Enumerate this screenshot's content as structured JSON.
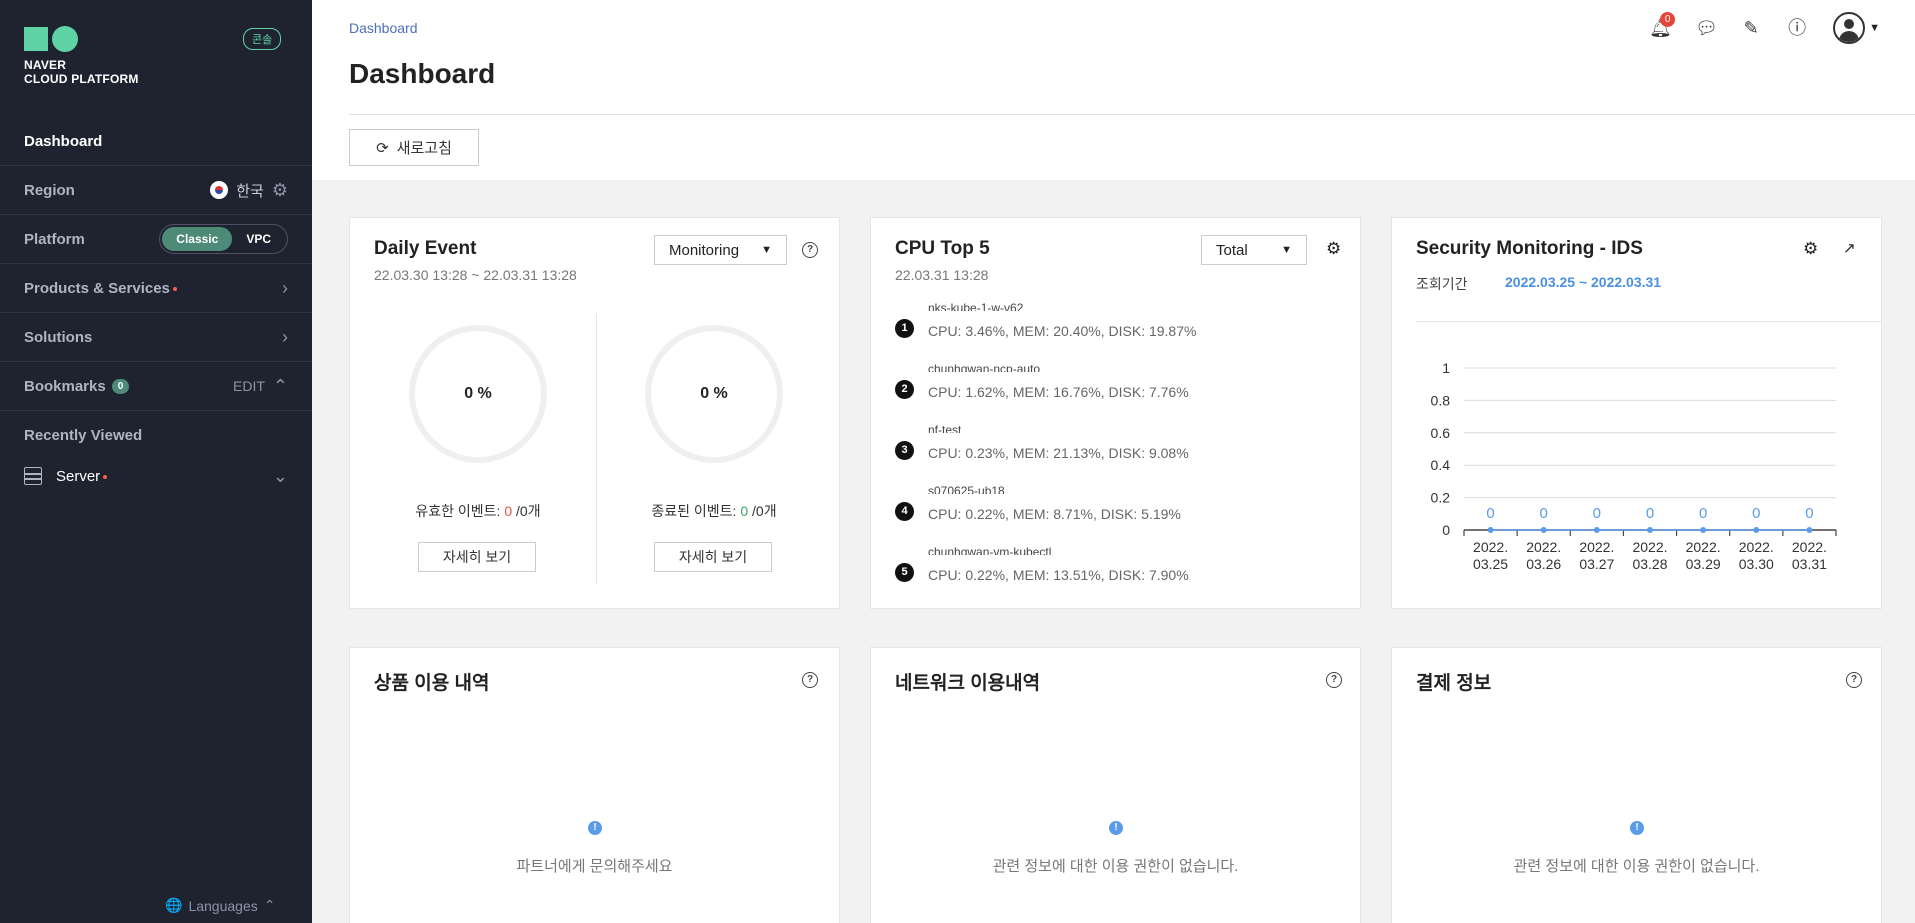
{
  "sidebar": {
    "logo_line1": "NAVER",
    "logo_line2": "CLOUD PLATFORM",
    "console_badge": "콘솔",
    "dashboard": "Dashboard",
    "region_label": "Region",
    "region_value": "한국",
    "platform_label": "Platform",
    "platform_classic": "Classic",
    "platform_vpc": "VPC",
    "products": "Products & Services",
    "solutions": "Solutions",
    "bookmarks": "Bookmarks",
    "bookmarks_count": "0",
    "bookmarks_edit": "EDIT",
    "recently_viewed": "Recently Viewed",
    "server": "Server",
    "languages": "Languages"
  },
  "header": {
    "breadcrumb": "Dashboard",
    "title": "Dashboard",
    "refresh": "새로고침",
    "notification_count": "0"
  },
  "daily_event": {
    "title": "Daily Event",
    "range": "22.03.30 13:28 ~ 22.03.31 13:28",
    "dropdown": "Monitoring",
    "left_value": "0 %",
    "right_value": "0 %",
    "left_label": "유효한 이벤트: ",
    "left_count": "0",
    "left_total": " /0개",
    "right_label": "종료된 이벤트: ",
    "right_count": "0",
    "right_total": " /0개",
    "detail": "자세히 보기"
  },
  "cpu_top5": {
    "title": "CPU Top 5",
    "time": "22.03.31 13:28",
    "dropdown": "Total",
    "items": [
      {
        "rank": "1",
        "name": "nks-kube-1-w-v62",
        "stat": "CPU: 3.46%, MEM: 20.40%, DISK: 19.87%"
      },
      {
        "rank": "2",
        "name": "chunhgwan-ncp-auto",
        "stat": "CPU: 1.62%, MEM: 16.76%, DISK: 7.76%"
      },
      {
        "rank": "3",
        "name": "nf-test",
        "stat": "CPU: 0.23%, MEM: 21.13%, DISK: 9.08%"
      },
      {
        "rank": "4",
        "name": "s070625-ub18",
        "stat": "CPU: 0.22%, MEM: 8.71%, DISK: 5.19%"
      },
      {
        "rank": "5",
        "name": "chunhgwan-vm-kubectl",
        "stat": "CPU: 0.22%, MEM: 13.51%, DISK: 7.90%"
      }
    ]
  },
  "ids": {
    "title": "Security Monitoring - IDS",
    "period_label": "조회기간",
    "period_value": "2022.03.25 ~ 2022.03.31"
  },
  "chart_data": {
    "type": "line",
    "categories": [
      "2022.03.25",
      "2022.03.26",
      "2022.03.27",
      "2022.03.28",
      "2022.03.29",
      "2022.03.30",
      "2022.03.31"
    ],
    "values": [
      0,
      0,
      0,
      0,
      0,
      0,
      0
    ],
    "ylim": [
      0,
      1
    ],
    "yticks": [
      "1",
      "0.8",
      "0.6",
      "0.4",
      "0.2",
      "0"
    ],
    "grid": true,
    "color": "#5b9be8"
  },
  "usage": {
    "title": "상품 이용 내역",
    "empty": "파트너에게 문의해주세요"
  },
  "network": {
    "title": "네트워크 이용내역",
    "empty": "관련 정보에 대한 이용 권한이 없습니다."
  },
  "billing": {
    "title": "결제 정보",
    "empty": "관련 정보에 대한 이용 권한이 없습니다."
  }
}
